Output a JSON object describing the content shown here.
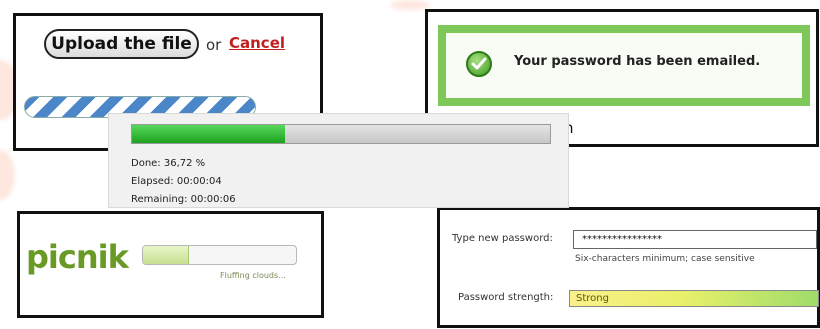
{
  "upload_panel": {
    "button_label": "Upload the file",
    "or_text": "or",
    "cancel_label": "Cancel"
  },
  "email_panel": {
    "message": "Your password has been emailed.",
    "partial_text": "n"
  },
  "progress_panel": {
    "done_label": "Done: 36,72 %",
    "done_fraction": 0.3672,
    "elapsed_label": "Elapsed: 00:00:04",
    "remaining_label": "Remaining: 00:00:06",
    "fill_color": "#2fc32f"
  },
  "picnik_panel": {
    "logo": "picnik",
    "status": "Fluffing clouds...",
    "progress_fraction": 0.3
  },
  "password_panel": {
    "new_password_label": "Type new password:",
    "password_value": "****************",
    "hint": "Six-characters minimum; case sensitive",
    "strength_label": "Password strength:",
    "strength_value": "Strong"
  },
  "colors": {
    "success_border": "#7ec85a",
    "cancel_link": "#c02020",
    "stripe_blue": "#4a86c8"
  }
}
